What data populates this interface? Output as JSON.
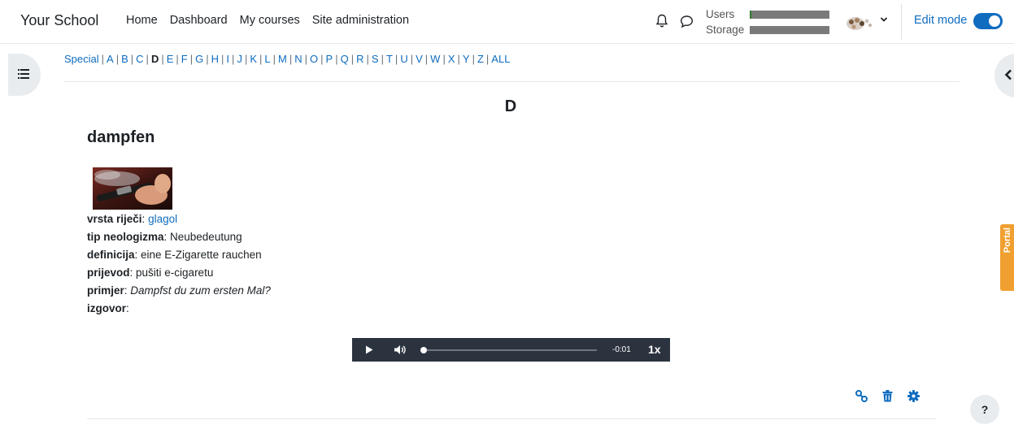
{
  "header": {
    "site_name": "Your School",
    "nav": [
      "Home",
      "Dashboard",
      "My courses",
      "Site administration"
    ],
    "quota_users_label": "Users",
    "quota_storage_label": "Storage",
    "users_fill_fraction": 0.02,
    "storage_fill_fraction": 0.0,
    "edit_mode_label": "Edit mode",
    "edit_mode_on": true
  },
  "alphabet": {
    "items": [
      "Special",
      "A",
      "B",
      "C",
      "D",
      "E",
      "F",
      "G",
      "H",
      "I",
      "J",
      "K",
      "L",
      "M",
      "N",
      "O",
      "P",
      "Q",
      "R",
      "S",
      "T",
      "U",
      "V",
      "W",
      "X",
      "Y",
      "Z",
      "ALL"
    ],
    "current": "D"
  },
  "entry": {
    "letter": "D",
    "title": "dampfen",
    "fields": [
      {
        "label": "vrsta riječi",
        "value": "glagol",
        "style": "link"
      },
      {
        "label": "tip neologizma",
        "value": "Neubedeutung",
        "style": "plain"
      },
      {
        "label": "definicija",
        "value": "eine E-Zigarette rauchen",
        "style": "plain"
      },
      {
        "label": "prijevod",
        "value": "pušiti e-cigaretu",
        "style": "plain"
      },
      {
        "label": "primjer",
        "value": "Dampfst du zum ersten Mal?",
        "style": "italic"
      },
      {
        "label": "izgovor",
        "value": "",
        "style": "plain"
      }
    ]
  },
  "player": {
    "time": "-0:01",
    "rate": "1x",
    "progress_fraction": 0.0
  },
  "side_tab": "Portal",
  "help_label": "?",
  "colors": {
    "link": "#0f6cbf",
    "player_bg": "#2b333f",
    "portal": "#f0a030",
    "quota_fill": "#2e7d32"
  }
}
